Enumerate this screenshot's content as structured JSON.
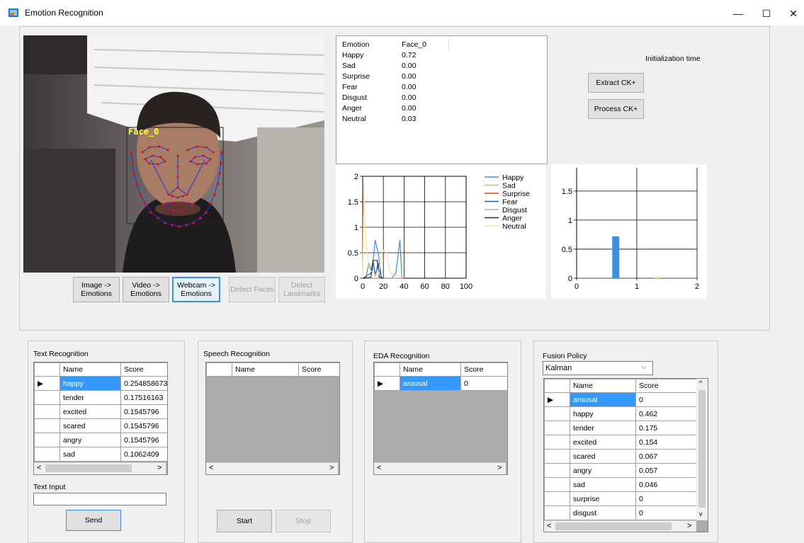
{
  "window": {
    "title": "Emotion Recognition",
    "controls": [
      "—",
      "☐",
      "✕"
    ]
  },
  "webcam": {
    "face_label": "Face_0"
  },
  "buttons": {
    "image": "Image -> Emotions",
    "video": "Video -> Emotions",
    "webcam": "Webcam -> Emotions",
    "detect_faces": "Detect Faces",
    "detect_landmarks": "Detect Landmarks",
    "extract": "Extract CK+",
    "process": "Process CK+"
  },
  "init_time_label": "Initialization time",
  "emotion_table": {
    "headers": [
      "Emotion",
      "Face_0"
    ],
    "rows": [
      [
        "Happy",
        "0.72"
      ],
      [
        "Sad",
        "0.00"
      ],
      [
        "Surprise",
        "0.00"
      ],
      [
        "Fear",
        "0.00"
      ],
      [
        "Disgust",
        "0.00"
      ],
      [
        "Anger",
        "0.00"
      ],
      [
        "Neutral",
        "0.03"
      ]
    ]
  },
  "chart_data": [
    {
      "type": "line",
      "xlim": [
        0,
        100
      ],
      "ylim": [
        0,
        2
      ],
      "xticks": [
        "0",
        "20",
        "40",
        "60",
        "80",
        "100"
      ],
      "yticks": [
        "0",
        "0.5",
        "1",
        "1.5",
        "2"
      ],
      "grid": true,
      "legend": "right",
      "series": [
        {
          "name": "Happy",
          "color": "#3b8ee0",
          "x": [
            0,
            3,
            6,
            9,
            12,
            15,
            18,
            20,
            24,
            28,
            32,
            36,
            38
          ],
          "y": [
            0,
            0,
            0.3,
            0.1,
            0.75,
            0.5,
            0.02,
            0,
            0,
            0,
            0.1,
            0.75,
            0
          ]
        },
        {
          "name": "Sad",
          "color": "#f0b030",
          "x": [
            0,
            20,
            40
          ],
          "y": [
            0,
            0,
            0
          ]
        },
        {
          "name": "Surprise",
          "color": "#e04020",
          "x": [
            0,
            20,
            40
          ],
          "y": [
            0,
            0,
            0
          ]
        },
        {
          "name": "Fear",
          "color": "#1a5aa8",
          "x": [
            0,
            4,
            8,
            10,
            12,
            15,
            18,
            20
          ],
          "y": [
            0,
            0.05,
            0.1,
            0.35,
            0.05,
            0.3,
            0,
            0
          ]
        },
        {
          "name": "Disgust",
          "color": "#b0b0b0",
          "x": [
            0,
            20,
            40
          ],
          "y": [
            0,
            0,
            0
          ]
        },
        {
          "name": "Anger",
          "color": "#20304a",
          "x": [
            0,
            8,
            10,
            14,
            16,
            20
          ],
          "y": [
            0,
            0.02,
            0.35,
            0.35,
            0.02,
            0
          ]
        },
        {
          "name": "Neutral",
          "color": "#f8e0a0",
          "x": [
            0,
            1,
            3,
            6,
            10,
            15,
            18,
            20,
            23,
            26,
            30,
            34,
            38
          ],
          "y": [
            0,
            1.85,
            0.8,
            0.2,
            0.1,
            0.05,
            0.4,
            0.55,
            0.5,
            0.15,
            0.05,
            0.05,
            0.05
          ]
        }
      ]
    },
    {
      "type": "bar",
      "xlim": [
        0,
        2
      ],
      "ylim": [
        0,
        1.9
      ],
      "xticks": [
        "0",
        "1",
        "2"
      ],
      "yticks": [
        "0",
        "0.5",
        "1",
        "1.5"
      ],
      "grid": true,
      "bars": [
        {
          "x": 0.65,
          "value": 0.72,
          "color": "#3b8ee0"
        },
        {
          "x": 1.35,
          "value": 0.03,
          "color": "#f8e0a0"
        }
      ]
    }
  ],
  "text_recognition": {
    "title": "Text Recognition",
    "headers": [
      "Name",
      "Score"
    ],
    "rows": [
      [
        "happy",
        "0.254858673"
      ],
      [
        "tender",
        "0.17516163"
      ],
      [
        "excited",
        "0.1545796"
      ],
      [
        "scared",
        "0.1545796"
      ],
      [
        "angry",
        "0.1545796"
      ],
      [
        "sad",
        "0.1062409"
      ]
    ],
    "input_label": "Text Input",
    "input_value": "",
    "send": "Send"
  },
  "speech_recognition": {
    "title": "Speech Recognition",
    "headers": [
      "Name",
      "Score"
    ],
    "start": "Start",
    "stop": "Stop"
  },
  "eda_recognition": {
    "title": "EDA Recognition",
    "headers": [
      "Name",
      "Score"
    ],
    "rows": [
      [
        "arousal",
        "0"
      ]
    ]
  },
  "fusion": {
    "title": "Fusion Policy",
    "policy": "Kalman",
    "headers": [
      "Name",
      "Score"
    ],
    "rows": [
      [
        "arousal",
        "0"
      ],
      [
        "happy",
        "0.462"
      ],
      [
        "tender",
        "0.175"
      ],
      [
        "excited",
        "0.154"
      ],
      [
        "scared",
        "0.067"
      ],
      [
        "angry",
        "0.057"
      ],
      [
        "sad",
        "0.046"
      ],
      [
        "surprise",
        "0"
      ],
      [
        "disgust",
        "0"
      ]
    ]
  }
}
